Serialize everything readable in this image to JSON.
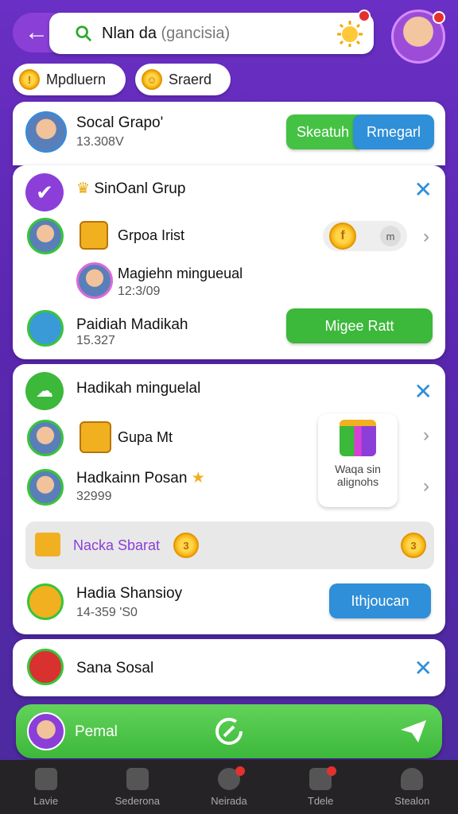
{
  "header": {
    "search_value": "Nlan da",
    "search_placeholder": "(gancisia)",
    "chips": [
      {
        "label": "Mpdluern"
      },
      {
        "label": "Sraerd"
      }
    ]
  },
  "social_group": {
    "title": "Socal Grapo'",
    "count": "13.308V",
    "btn_search": "Skeatuh",
    "btn_remegall": "Rmegarl"
  },
  "section1": {
    "title": "SinOanl Grup",
    "row1_title": "Grpoa Irist",
    "row1_badge": "m",
    "row2_title": "Magiehn mingueual",
    "row2_sub": "12:3/09",
    "row3_title": "Paidiah Madikah",
    "row3_sub": "15.327",
    "row3_btn": "Migee Ratt"
  },
  "section2": {
    "title": "Hadikah minguelal",
    "row1_title": "Gupa Mt",
    "row2_title": "Hadkainn Posan",
    "row2_sub": "32999",
    "promo_line1": "Waqa sin",
    "promo_line2": "alignohs",
    "banner_text": "Nacka Sbarat",
    "row3_title": "Hadia Shansioy",
    "row3_sub": "14-359 'S0",
    "row3_btn": "Ithjoucan"
  },
  "section3": {
    "title": "Sana Sosal"
  },
  "cta": {
    "label": "Pemal"
  },
  "tabs": [
    {
      "label": "Lavie"
    },
    {
      "label": "Sederona"
    },
    {
      "label": "Neirada"
    },
    {
      "label": "Tdele"
    },
    {
      "label": "Stealon"
    }
  ],
  "colors": {
    "accent_green": "#3cb83b",
    "accent_blue": "#2f8fd8",
    "background_purple": "#6a2fc4"
  }
}
